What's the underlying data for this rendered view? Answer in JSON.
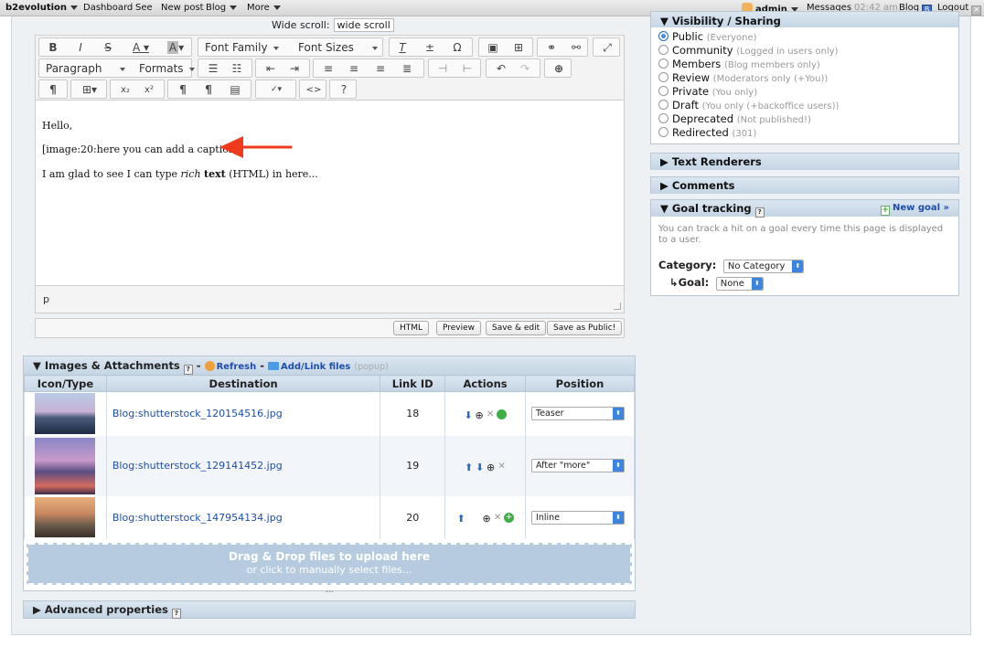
{
  "topbar": {
    "brand": "b2evolution",
    "items": [
      "Dashboard",
      "See",
      "New post",
      "Blog",
      "More"
    ],
    "user": "admin",
    "messages": "Messages",
    "time": "02:42 am",
    "blog": "Blog",
    "logout": "Logout"
  },
  "editor": {
    "wide_scroll_label": "Wide scroll:",
    "wide_scroll_value": "wide scroll",
    "toolbar": {
      "font_family": "Font Family",
      "font_sizes": "Font Sizes",
      "paragraph": "Paragraph",
      "formats": "Formats"
    },
    "content": {
      "line1": "Hello,",
      "line2": "[image:20:here you can add a caption]",
      "line3_pre": "I am glad to see I can type ",
      "line3_em": "rich",
      "line3_strong": "text",
      "line3_post": " (HTML) in here..."
    },
    "path": "p",
    "buttons": {
      "html": "HTML",
      "preview": "Preview",
      "save_edit": "Save & edit",
      "save_public": "Save as Public!"
    }
  },
  "visibility": {
    "title": "Visibility / Sharing",
    "options": [
      {
        "label": "Public",
        "note": "(Everyone)",
        "selected": true
      },
      {
        "label": "Community",
        "note": "(Logged in users only)",
        "selected": false
      },
      {
        "label": "Members",
        "note": "(Blog members only)",
        "selected": false
      },
      {
        "label": "Review",
        "note": "(Moderators only (+You))",
        "selected": false
      },
      {
        "label": "Private",
        "note": "(You only)",
        "selected": false
      },
      {
        "label": "Draft",
        "note": "(You only (+backoffice users))",
        "selected": false
      },
      {
        "label": "Deprecated",
        "note": "(Not published!)",
        "selected": false
      },
      {
        "label": "Redirected",
        "note": "(301)",
        "selected": false
      }
    ]
  },
  "text_renderers": {
    "title": "Text Renderers"
  },
  "comments": {
    "title": "Comments"
  },
  "goal_tracking": {
    "title": "Goal tracking",
    "new_goal": "New goal »",
    "description": "You can track a hit on a goal every time this page is displayed to a user.",
    "category_label": "Category:",
    "category_value": "No Category",
    "goal_label": "Goal:",
    "goal_value": "None"
  },
  "attachments": {
    "title": "Images & Attachments",
    "refresh": "Refresh",
    "add_link": "Add/Link files",
    "popup": "(popup)",
    "columns": [
      "Icon/Type",
      "Destination",
      "Link ID",
      "Actions",
      "Position"
    ],
    "rows": [
      {
        "file": "Blog:shutterstock_120154516.jpg",
        "link_id": "18",
        "position": "Teaser"
      },
      {
        "file": "Blog:shutterstock_129141452.jpg",
        "link_id": "19",
        "position": "After \"more\""
      },
      {
        "file": "Blog:shutterstock_147954134.jpg",
        "link_id": "20",
        "position": "Inline"
      }
    ],
    "drop_line1": "Drag & Drop files to upload here",
    "drop_line2": "or click to manually select files...",
    "dots": "..."
  },
  "advanced": {
    "title": "Advanced properties"
  },
  "colors": {
    "accent": "#1f4ea8",
    "panel_head": "#c5d5e4",
    "arrow_red": "#f03a1e",
    "radio_on": "#3d8ee8"
  }
}
